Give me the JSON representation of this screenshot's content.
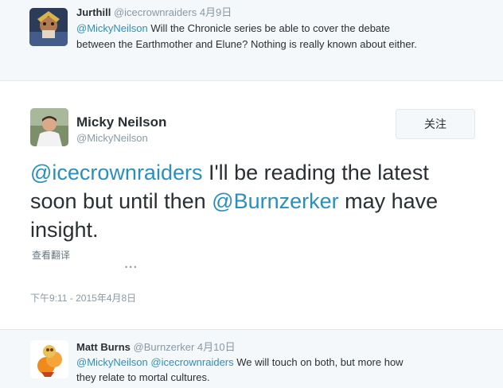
{
  "reply_above": {
    "name": "Jurthill",
    "handle": "@icecrownraiders",
    "date": "4月9日",
    "mention": "@MickyNeilson",
    "text_line1": " Will the Chronicle series be able to cover the debate",
    "text_line2": "between the Earthmother and Elune? Nothing is really known about either."
  },
  "main_tweet": {
    "name": "Micky Neilson",
    "handle": "@MickyNeilson",
    "follow_label": "关注",
    "mention1": "@icecrownraiders",
    "text_part1": " I'll be reading the latest soon but until then ",
    "mention2": "@Burnzerker",
    "text_part2": " may have insight.",
    "translate_label": "查看翻译",
    "dots": "• • •",
    "timestamp": "下午9:11 - 2015年4月8日"
  },
  "reply_below": {
    "name": "Matt Burns",
    "handle": "@Burnzerker",
    "date": "4月10日",
    "mention1": "@MickyNeilson",
    "mention2": "@icecrownraiders",
    "text_line1": " We will touch on both, but more how",
    "text_line2": "they relate to mortal cultures."
  },
  "colors": {
    "link": "#2a8fbd",
    "meta_gray": "#8899a6",
    "band_bg": "#f5f8fa"
  }
}
